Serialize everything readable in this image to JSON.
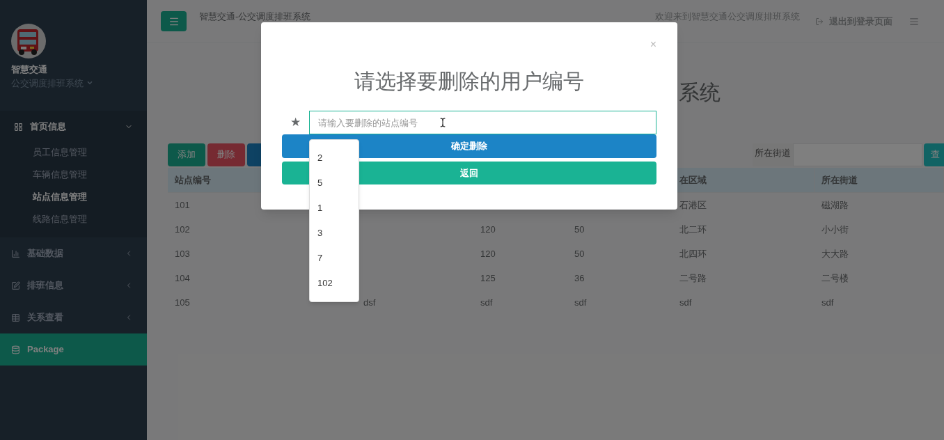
{
  "sidebar": {
    "brand": "智慧交通",
    "subtitle": "公交调度排班系统",
    "items": [
      {
        "kind": "group",
        "label": "首页信息",
        "expanded": true,
        "selected": false,
        "children": [
          {
            "label": "员工信息管理",
            "selected": false
          },
          {
            "label": "车辆信息管理",
            "selected": false
          },
          {
            "label": "站点信息管理",
            "selected": true
          },
          {
            "label": "线路信息管理",
            "selected": false
          }
        ]
      },
      {
        "kind": "group",
        "label": "基础数据",
        "expanded": false,
        "selected": false
      },
      {
        "kind": "group",
        "label": "排班信息",
        "expanded": false,
        "selected": false
      },
      {
        "kind": "group",
        "label": "关系查看",
        "expanded": false,
        "selected": false
      },
      {
        "kind": "link",
        "label": "Package",
        "selected": true
      }
    ]
  },
  "topbar": {
    "title": "智慧交通-公交调度排班系统",
    "welcome": "欢迎来到智慧交通公交调度排班系统",
    "logout": "退出到登录页面"
  },
  "page_heading": "系统",
  "toolbar": {
    "buttons": [
      {
        "kind": "add",
        "label": "添加"
      },
      {
        "kind": "delete",
        "label": "删除"
      },
      {
        "kind": "edit"
      }
    ],
    "search_label": "所在街道",
    "search_button": "查"
  },
  "table": {
    "columns": [
      "站点编号",
      null,
      null,
      null,
      "在区域",
      "所在街道"
    ],
    "rows": [
      [
        "101",
        null,
        null,
        null,
        "石港区",
        "磁湖路"
      ],
      [
        "102",
        null,
        "120",
        "50",
        "北二环",
        "小小街"
      ],
      [
        "103",
        null,
        "120",
        "50",
        "北四环",
        "大大路"
      ],
      [
        "104",
        null,
        "125",
        "36",
        "二号路",
        "二号楼"
      ],
      [
        "105",
        "dsf",
        "sdf",
        "sdf",
        "sdf",
        "sdf"
      ]
    ]
  },
  "modal": {
    "title": "请选择要删除的用户编号",
    "required_mark": "★",
    "close": "×",
    "input": {
      "placeholder": "请输入要删除的站点编号"
    },
    "suggestions": [
      "2",
      "5",
      "1",
      "3",
      "7",
      "102"
    ],
    "confirm": "确定删除",
    "back": "返回"
  }
}
